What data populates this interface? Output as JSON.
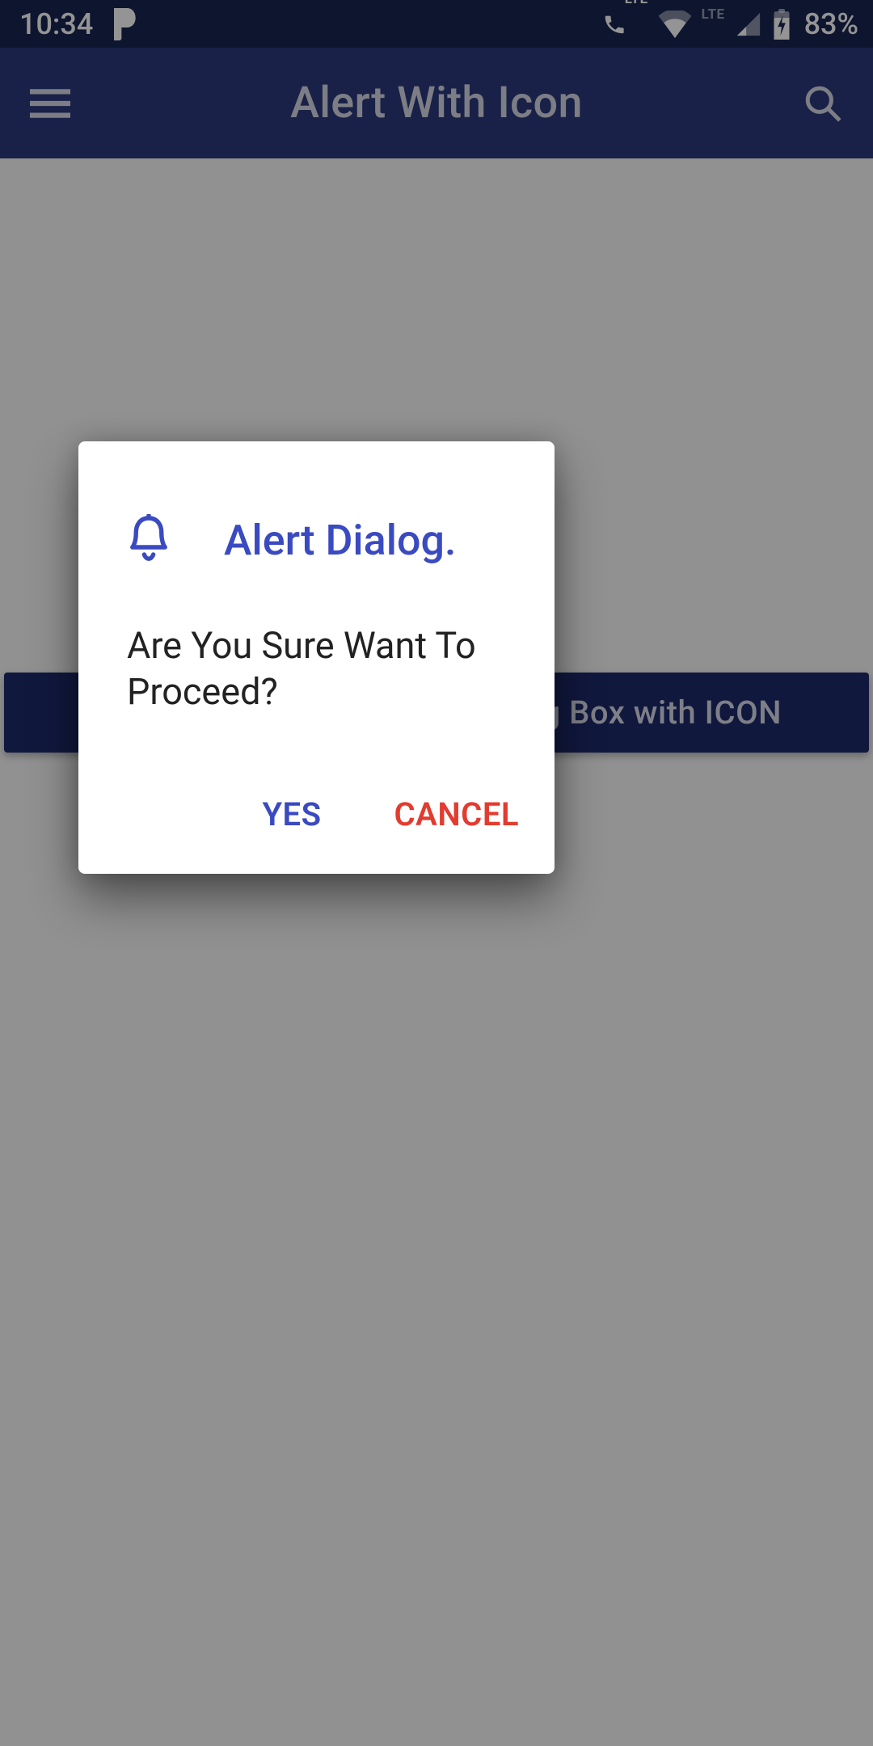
{
  "status": {
    "time": "10:34",
    "battery_pct": "83%",
    "lte_label_1": "LTE",
    "lte_label_2": "LTE"
  },
  "appbar": {
    "title": "Alert With Icon"
  },
  "content": {
    "button_label": "Click Here To Show Alert Dialog Box with ICON"
  },
  "dialog": {
    "title": "Alert Dialog.",
    "message": "Are You Sure Want To Proceed?",
    "yes": "YES",
    "cancel": "CANCEL"
  }
}
